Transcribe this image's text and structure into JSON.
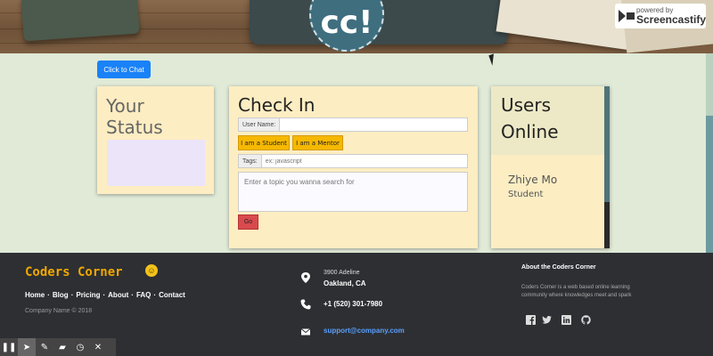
{
  "logo": {
    "text": "cc!"
  },
  "watermark": {
    "line1": "powered by",
    "line2": "Screencastify"
  },
  "chat_button": {
    "label": "Click to Chat"
  },
  "status_card": {
    "title": "Your Status"
  },
  "checkin": {
    "title": "Check In",
    "user_label": "User Name:",
    "user_value": "",
    "student_label": "I am a Student",
    "mentor_label": "I am a Mentor",
    "tags_label": "Tags:",
    "tags_placeholder": "ex: javascript",
    "topic_placeholder": "Enter a topic you wanna search for",
    "go_label": "Go"
  },
  "users_online": {
    "title": "Users Online",
    "users": [
      {
        "name": "Zhiye Mo",
        "role": "Student"
      }
    ]
  },
  "footer": {
    "brand": "Coders Corner",
    "links": [
      "Home",
      "Blog",
      "Pricing",
      "About",
      "FAQ",
      "Contact"
    ],
    "copyright": "Company Name © 2018",
    "address_line1": "3900 Adeline",
    "address_line2": "Oakland, CA",
    "phone": "+1 (520) 301-7980",
    "email": "support@company.com",
    "about_title": "About the Coders Corner",
    "about_text": "Coders Corner is a web based online learning community where knowledges meet and spark"
  },
  "icons": [
    "map-marker-icon",
    "phone-icon",
    "envelope-icon",
    "facebook-icon",
    "twitter-icon",
    "linkedin-icon",
    "github-icon"
  ],
  "colors": {
    "accent": "#1a82f7",
    "brand": "#f1a800",
    "card": "#fdedc2",
    "footer": "#2d2f33",
    "go": "#d94a4f"
  }
}
